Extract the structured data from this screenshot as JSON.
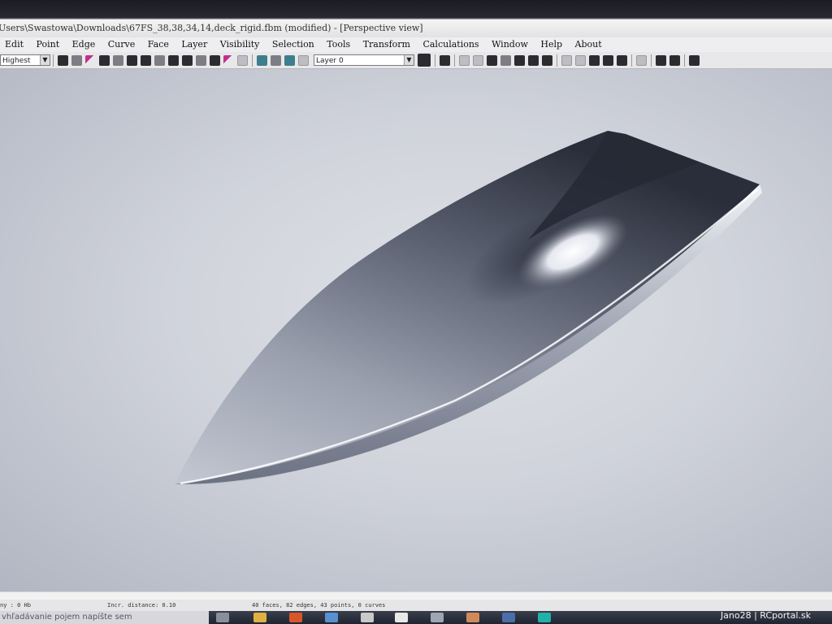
{
  "window": {
    "title": "Users\\Swastowa\\Downloads\\67FS_38,38,34,14,deck_rigid.fbm (modified) - [Perspective view]"
  },
  "menu": {
    "items": [
      "Edit",
      "Point",
      "Edge",
      "Curve",
      "Face",
      "Layer",
      "Visibility",
      "Selection",
      "Tools",
      "Transform",
      "Calculations",
      "Window",
      "Help",
      "About"
    ]
  },
  "toolbar": {
    "precision_combo": "Highest",
    "layer_combo": "Layer 0"
  },
  "viewport": {
    "label": "Perspective view"
  },
  "status": {
    "left": "ny : 0 Hb",
    "increment": "Incr. distance: 0.10",
    "counts": "40 faces, 82 edges, 43 points, 0 curves"
  },
  "taskbar": {
    "left_text": "vhľadávanie pojem napíšte sem"
  },
  "watermark": "Jano28 | RCportal.sk"
}
